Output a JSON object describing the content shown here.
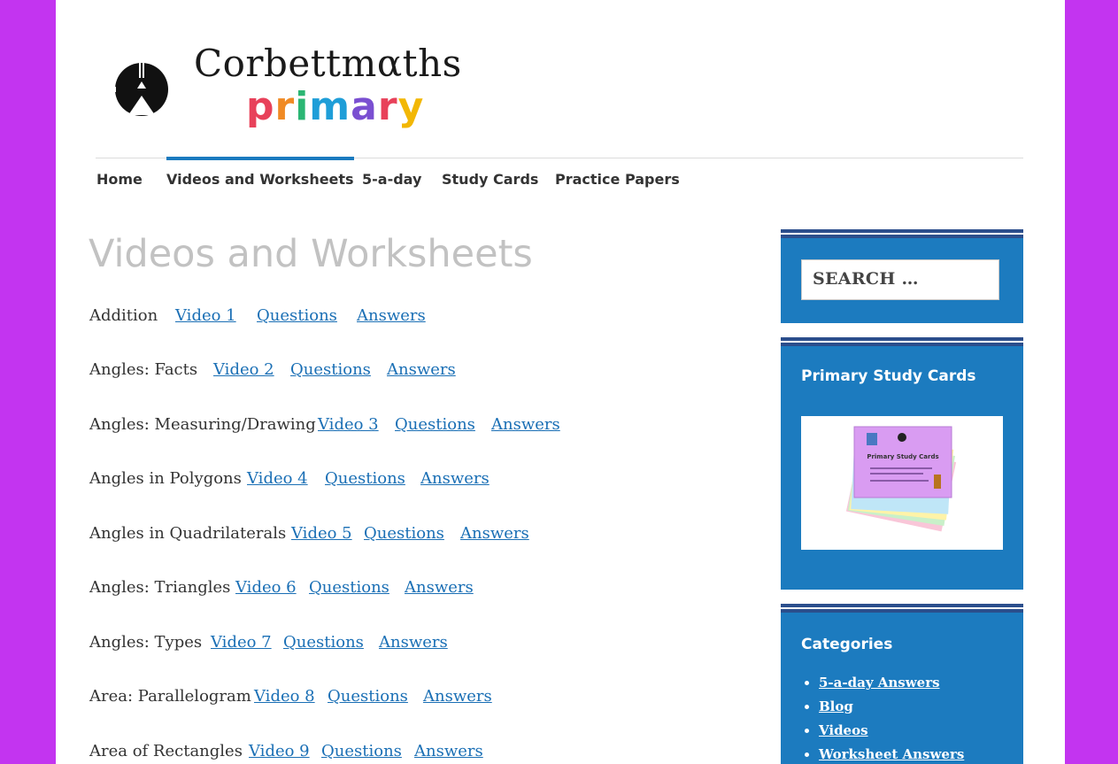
{
  "logo": {
    "wordmark": "Corbettmαths",
    "subtitle": "primary"
  },
  "nav": [
    "Home",
    "Videos and Worksheets",
    "5-a-day",
    "Study Cards",
    "Practice Papers"
  ],
  "page_title": "Videos and Worksheets",
  "topics": [
    {
      "label": "Addition",
      "video": "Video 1",
      "questions": "Questions",
      "answers": "Answers"
    },
    {
      "label": "Angles: Facts",
      "video": "Video 2",
      "questions": "Questions",
      "answers": "Answers"
    },
    {
      "label": "Angles: Measuring/Drawing",
      "video": "Video 3",
      "questions": "Questions",
      "answers": "Answers"
    },
    {
      "label": "Angles in Polygons",
      "video": "Video 4",
      "questions": "Questions",
      "answers": "Answers"
    },
    {
      "label": "Angles in Quadrilaterals",
      "video": "Video 5",
      "questions": "Questions",
      "answers": "Answers"
    },
    {
      "label": "Angles: Triangles",
      "video": "Video 6",
      "questions": "Questions",
      "answers": "Answers"
    },
    {
      "label": "Angles: Types",
      "video": "Video 7",
      "questions": "Questions",
      "answers": "Answers"
    },
    {
      "label": "Area: Parallelogram",
      "video": "Video 8",
      "questions": "Questions",
      "answers": "Answers"
    },
    {
      "label": "Area of Rectangles",
      "video": "Video 9",
      "questions": "Questions",
      "answers": "Answers"
    }
  ],
  "sidebar": {
    "search_placeholder": "SEARCH …",
    "study_cards_title": "Primary Study Cards",
    "study_cards_image_text": "Primary Study Cards",
    "categories_title": "Categories",
    "categories": [
      "5-a-day Answers",
      "Blog",
      "Videos",
      "Worksheet Answers"
    ]
  },
  "colors": {
    "background": "#c334f0",
    "link": "#1a6fb5",
    "sidebar_widget": "#1c7bbf",
    "nav_active": "#1a7abf"
  }
}
